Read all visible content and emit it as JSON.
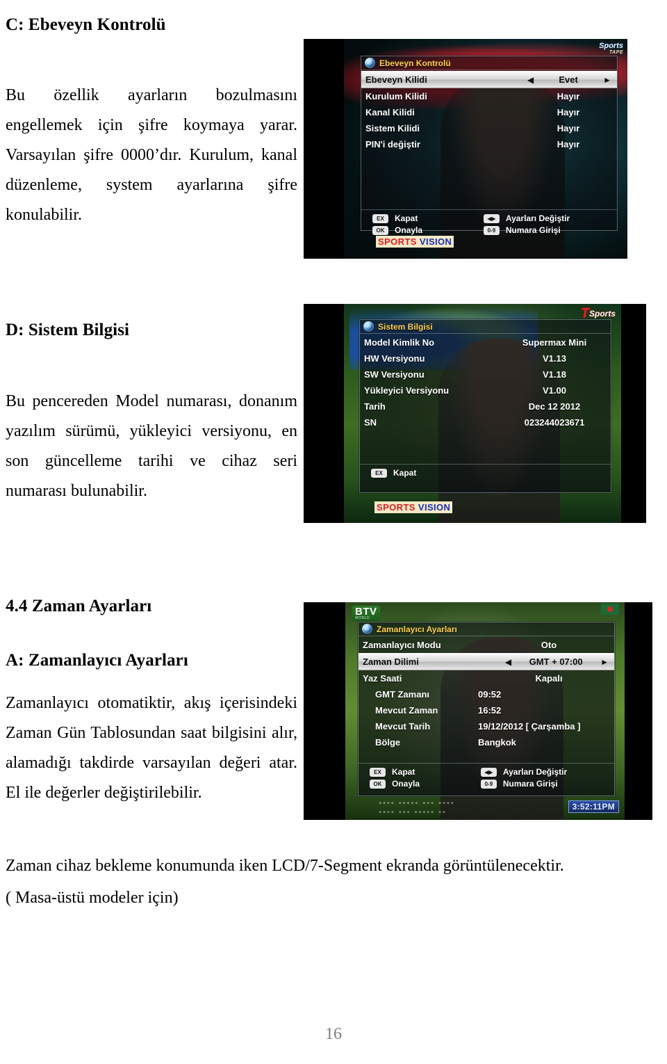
{
  "document": {
    "page_number": "16",
    "sections": [
      {
        "heading": "C: Ebeveyn Kontrolü",
        "body": "Bu özellik ayarların bozulmasını engellemek için şifre koymaya yarar. Varsayılan şifre 0000’dır. Kurulum, kanal düzenleme, system ayarlarına şifre konulabilir."
      },
      {
        "heading": "D: Sistem Bilgisi",
        "body": "Bu pencereden Model numarası, donanım yazılım sürümü, yükleyici versiyonu, en son güncelleme tarihi ve cihaz seri numarası bulunabilir."
      },
      {
        "heading": "4.4 Zaman Ayarları",
        "subheading": "A: Zamanlayıcı Ayarları",
        "body": "Zamanlayıcı otomatiktir, akış içerisindeki Zaman Gün Tablosundan saat bilgisini alır, alamadığı takdirde varsayılan değeri atar. El ile değerler değiştirilebilir."
      }
    ],
    "footer_note_line1": "Zaman cihaz bekleme konumunda iken LCD/7-Segment ekranda görüntülenecektir.",
    "footer_note_line2": "( Masa-üstü modeler için)"
  },
  "screenshot_1": {
    "channel_bug": "Sports",
    "channel_bug_sub": "TAPE",
    "menu_title": "Ebeveyn Kontrolü",
    "rows": [
      {
        "label": "Ebeveyn Kilidi",
        "value": "Evet",
        "selected": true
      },
      {
        "label": "Kurulum Kilidi",
        "value": "Hayır",
        "selected": false
      },
      {
        "label": "Kanal Kilidi",
        "value": "Hayır",
        "selected": false
      },
      {
        "label": "Sistem Kilidi",
        "value": "Hayır",
        "selected": false
      },
      {
        "label": "PIN'i değiştir",
        "value": "Hayır",
        "selected": false
      }
    ],
    "hints": [
      {
        "key": "EX",
        "text": "Kapat"
      },
      {
        "key": "◀▶",
        "text": "Ayarları Değiştir"
      },
      {
        "key": "OK",
        "text": "Onayla"
      },
      {
        "key": "0-9",
        "text": "Numara Girişi"
      }
    ],
    "logo_part1": "SPORTS",
    "logo_part2": "VISION"
  },
  "screenshot_2": {
    "channel_bug": "Sports",
    "channel_bug_prefix": "T",
    "menu_title": "Sistem Bilgisi",
    "rows": [
      {
        "label": "Model Kimlik No",
        "value": "Supermax Mini"
      },
      {
        "label": "HW Versiyonu",
        "value": "V1.13"
      },
      {
        "label": "SW Versiyonu",
        "value": "V1.18"
      },
      {
        "label": "Yükleyici Versiyonu",
        "value": "V1.00"
      },
      {
        "label": "Tarih",
        "value": "Dec 12 2012"
      },
      {
        "label": "SN",
        "value": "023244023671"
      }
    ],
    "hints": [
      {
        "key": "EX",
        "text": "Kapat"
      }
    ],
    "logo_part1": "SPORTS",
    "logo_part2": "VISION"
  },
  "screenshot_3": {
    "channel_bug": "BTV",
    "channel_bug_sub": "WORLD",
    "menu_title": "Zamanlayıcı Ayarları",
    "rows": [
      {
        "label": "Zamanlayıcı Modu",
        "value": "Oto",
        "selected": false,
        "indent": false
      },
      {
        "label": "Zaman Dilimi",
        "value": "GMT + 07:00",
        "selected": true,
        "indent": false
      },
      {
        "label": "Yaz Saati",
        "value": "Kapalı",
        "selected": false,
        "indent": false
      },
      {
        "label": "GMT Zamanı",
        "value": "09:52",
        "selected": false,
        "indent": true
      },
      {
        "label": "Mevcut Zaman",
        "value": "16:52",
        "selected": false,
        "indent": true
      },
      {
        "label": "Mevcut Tarih",
        "value": "19/12/2012 [ Çarşamba ]",
        "selected": false,
        "indent": true
      },
      {
        "label": "Bölge",
        "value": "Bangkok",
        "selected": false,
        "indent": true
      }
    ],
    "hints": [
      {
        "key": "EX",
        "text": "Kapat"
      },
      {
        "key": "◀▶",
        "text": "Ayarları Değiştir"
      },
      {
        "key": "OK",
        "text": "Onayla"
      },
      {
        "key": "0-9",
        "text": "Numara Girişi"
      }
    ],
    "clock": "3:52:11PM"
  }
}
